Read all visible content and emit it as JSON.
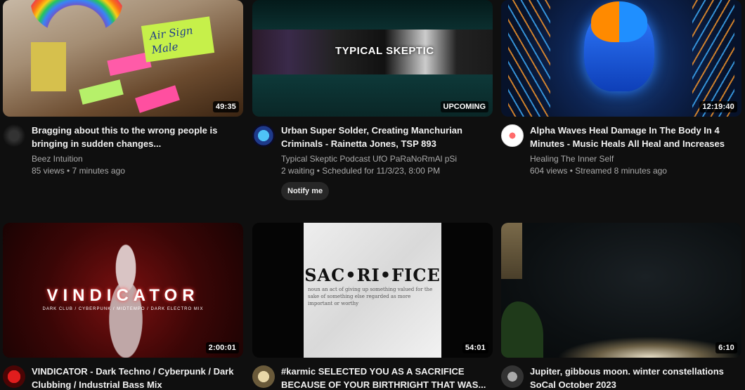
{
  "videos": [
    {
      "title": "Bragging about this to the wrong people is bringing in sudden changes...",
      "channel": "Beez Intuition",
      "stats": "85 views • 7 minutes ago",
      "duration": "49:35",
      "thumb_text": "Air Sign Male"
    },
    {
      "title": "Urban Super Solder, Creating Manchurian Criminals - Rainetta Jones, TSP 893",
      "channel": "Typical Skeptic Podcast UfO PaRaNoRmAl pSi",
      "stats": "2 waiting • Scheduled for 11/3/23, 8:00 PM",
      "duration": "UPCOMING",
      "thumb_text": "TYPICAL SKEPTIC",
      "notify_label": "Notify me"
    },
    {
      "title": "Alpha Waves Heal Damage In The Body In 4 Minutes - Music Heals All Heal and Increases",
      "channel": "Healing The Inner Self",
      "stats": "604 views • Streamed 8 minutes ago",
      "duration": "12:19:40"
    },
    {
      "title": "VINDICATOR - Dark Techno / Cyberpunk / Dark Clubbing / Industrial Bass Mix",
      "duration": "2:00:01",
      "thumb_text": "VINDICATOR",
      "thumb_sub": "DARK CLUB / CYBERPUNK / MIDTEMPO / DARK ELECTRO MIX"
    },
    {
      "title": "#karmic SELECTED YOU AS A SACRIFICE BECAUSE OF YOUR BIRTHRIGHT THAT WAS...",
      "duration": "54:01",
      "thumb_text": "SAC•RI•FICE",
      "thumb_sub": "noun an act of giving up something valued for the sake of something else regarded as more important or worthy"
    },
    {
      "title": "Jupiter, gibbous moon. winter constellations SoCal October 2023",
      "duration": "6:10"
    }
  ],
  "colors": {
    "background": "#0f0f0f",
    "title_text": "#f1f1f1",
    "meta_text": "#aaaaaa",
    "button_bg": "#272727"
  }
}
